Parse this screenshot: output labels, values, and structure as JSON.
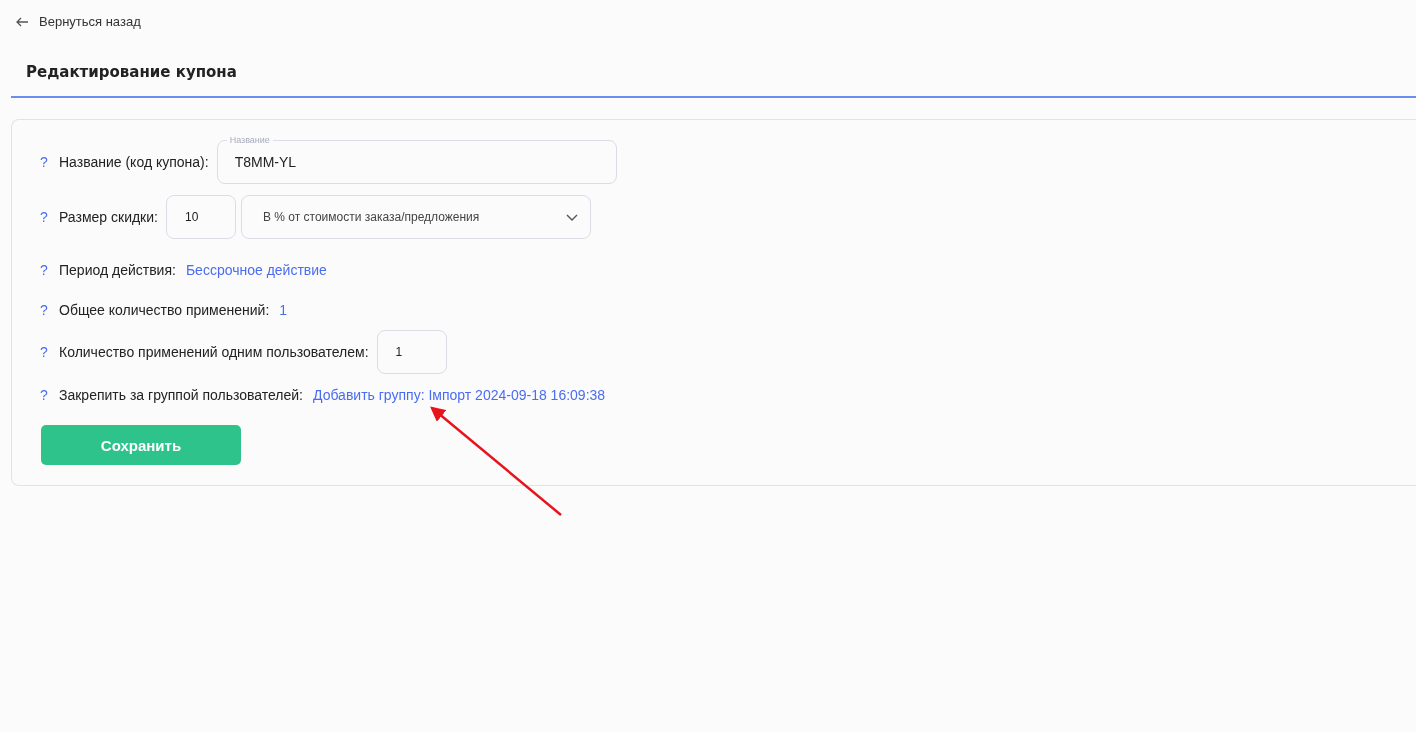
{
  "back_link": "Вернуться назад",
  "title": "Редактирование купона",
  "rows": [
    {
      "kind": "text_field",
      "help": "?",
      "label": "Название (код купона):",
      "floating_label": "Название",
      "value": "T8MM-YL"
    },
    {
      "kind": "number_select",
      "help": "?",
      "label": "Размер скидки:",
      "value": "10",
      "select_value": "В % от стоимости заказа/предложения"
    },
    {
      "kind": "link",
      "help": "?",
      "label": "Период действия:",
      "value": "Бессрочное действие"
    },
    {
      "kind": "link",
      "help": "?",
      "label": "Общее количество применений:",
      "value": "1"
    },
    {
      "kind": "number",
      "help": "?",
      "label": "Количество применений одним пользователем:",
      "value": "1"
    },
    {
      "kind": "link",
      "help": "?",
      "label": "Закрепить за группой пользователей:",
      "value": "Добавить группу: Імпорт 2024-09-18 16:09:38"
    }
  ],
  "save_button": "Сохранить"
}
